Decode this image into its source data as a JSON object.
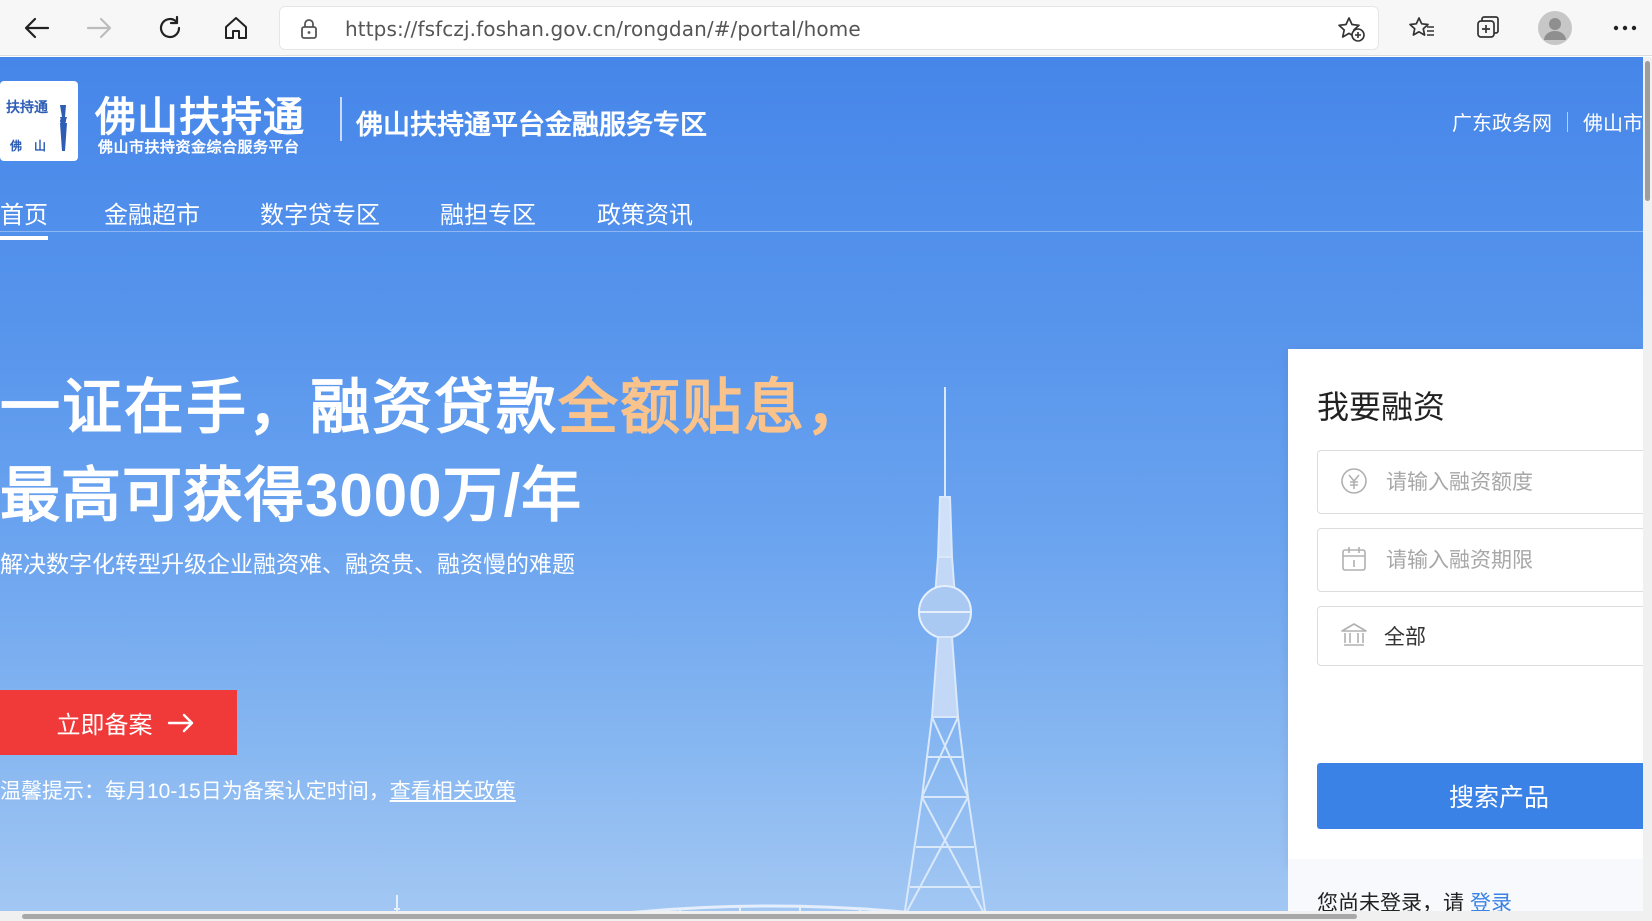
{
  "browser": {
    "url": "https://fsfczj.foshan.gov.cn/rongdan/#/portal/home"
  },
  "header": {
    "logo_box_top": "扶持通",
    "logo_box_bottom": "佛山",
    "logo_title": "佛山扶持通",
    "logo_subtitle": "佛山市扶持资金综合服务平台",
    "platform_title": "佛山扶持通平台金融服务专区",
    "links": [
      "广东政务网",
      "佛山市"
    ]
  },
  "nav": {
    "items": [
      "首页",
      "金融超市",
      "数字贷专区",
      "融担专区",
      "政策资讯"
    ],
    "active_index": 0
  },
  "hero": {
    "line1_prefix": "一证在手，融资贷款",
    "line1_highlight": "全额贴息，",
    "line2": "最高可获得3000万/年",
    "subtitle": "解决数字化转型升级企业融资难、融资贵、融资慢的难题",
    "cta_label": "立即备案",
    "tip_prefix": "温馨提示：每月10-15日为备案认定时间，",
    "tip_link": "查看相关政策"
  },
  "finance_panel": {
    "title": "我要融资",
    "amount_placeholder": "请输入融资额度",
    "term_placeholder": "请输入融资期限",
    "bank_value": "全部",
    "search_label": "搜索产品",
    "login_prompt": "您尚未登录，请",
    "login_link": "登录"
  },
  "colors": {
    "page_blue": "#4686e9",
    "highlight_orange": "#f9c38b",
    "cta_red": "#f03a3a",
    "button_blue": "#3b82e6"
  }
}
